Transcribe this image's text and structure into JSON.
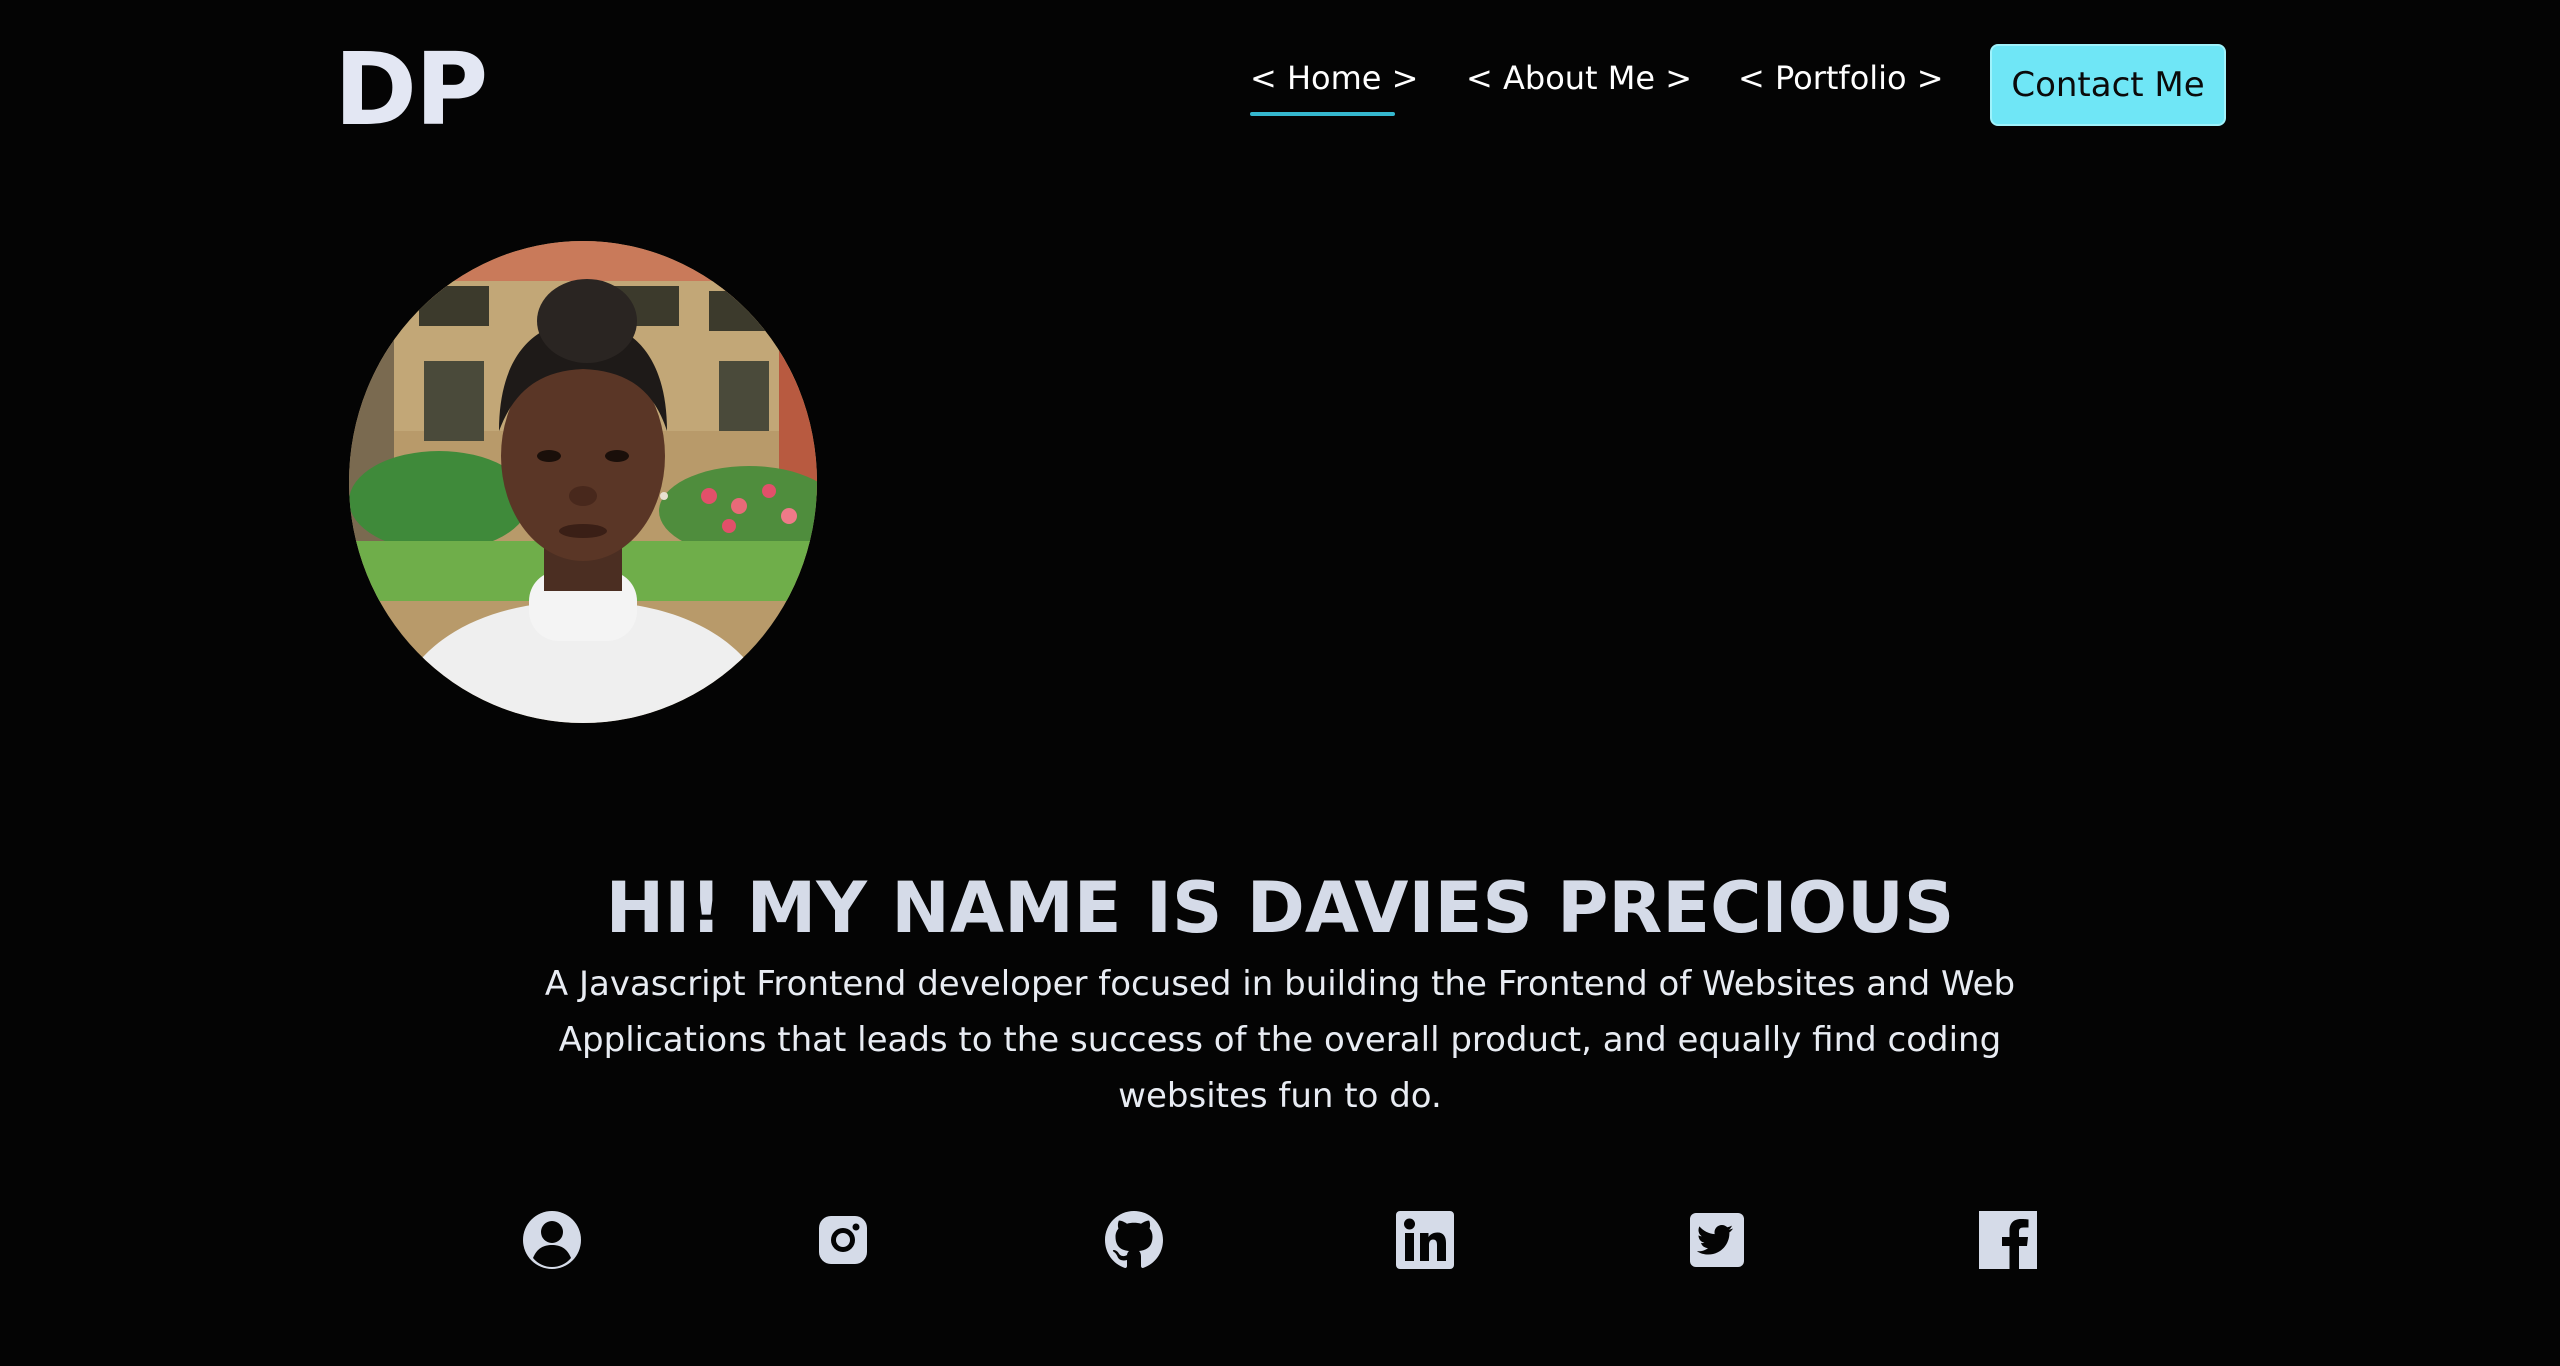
{
  "header": {
    "logo": "DP",
    "nav": [
      {
        "label": "< Home >",
        "active": true
      },
      {
        "label": "< About Me >",
        "active": false
      },
      {
        "label": "< Portfolio >",
        "active": false
      }
    ],
    "contact_label": "Contact Me",
    "accent_color": "#35b8cf",
    "button_color": "#6fe6f6"
  },
  "hero": {
    "title": "HI! MY NAME IS DAVIES PRECIOUS",
    "description": "A Javascript Frontend developer focused in building the Frontend of Websites and Web Applications that leads to the success of the overall product, and equally find coding websites fun to do."
  },
  "socials": [
    {
      "icon": "user-circle-icon"
    },
    {
      "icon": "instagram-icon"
    },
    {
      "icon": "github-icon"
    },
    {
      "icon": "linkedin-icon"
    },
    {
      "icon": "twitter-icon"
    },
    {
      "icon": "facebook-icon"
    }
  ]
}
